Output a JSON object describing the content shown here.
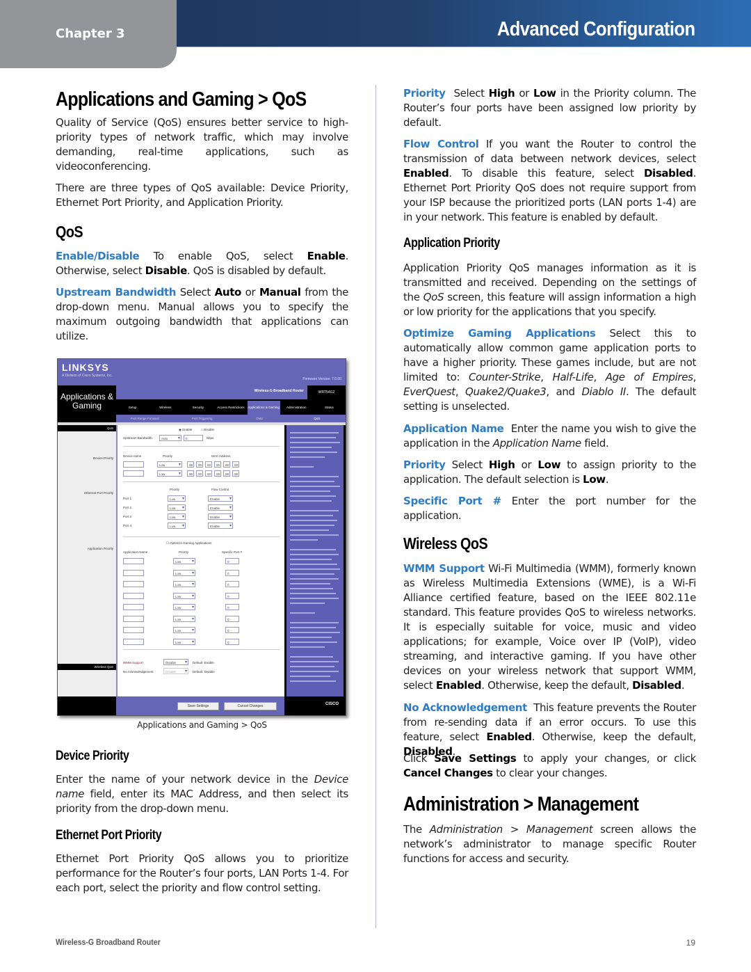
{
  "header": {
    "chapter": "Chapter 3",
    "title": "Advanced Configuration"
  },
  "left": {
    "title": "Applications and Gaming > QoS",
    "intro1": "Quality of Service (QoS) ensures better service to high-priority types of network traffic, which may involve demanding, real-time applications, such as videoconferencing.",
    "intro2": "There are three types of QoS available: Device Priority, Ethernet Port Priority, and Application Priority.",
    "qos_heading": "QoS",
    "enable_term": "Enable/Disable",
    "enable_t1": " To enable QoS, select ",
    "enable_b1": "Enable",
    "enable_t2": ". Otherwise, select ",
    "enable_b2": "Disable",
    "enable_t3": ". QoS is disabled by default.",
    "upstream_term": "Upstream Bandwidth",
    "upstream_t1": " Select ",
    "upstream_b1": "Auto",
    "upstream_t2": " or ",
    "upstream_b2": "Manual",
    "upstream_t3": " from the drop-down menu. Manual allows you to specify the maximum outgoing bandwidth that applications can utilize.",
    "figure_caption": "Applications and Gaming > QoS",
    "device_heading": "Device Priority",
    "device_t1": "Enter the name of your network device in the ",
    "device_i1": "Device name",
    "device_t2": " field, enter its MAC Address, and then select its priority from the drop-down menu.",
    "ethernet_heading": "Ethernet Port Priority",
    "ethernet_text": "Ethernet Port Priority QoS allows you to prioritize performance for the Router’s four ports, LAN Ports 1-4. For each port, select the priority and flow control setting."
  },
  "figure": {
    "logo": "LINKSYS",
    "logo_sub": "A Division of Cisco Systems, Inc.",
    "firmware": "Firmware Version: 7.0.00",
    "section": "Applications & Gaming",
    "product": "Wireless-G Broadband Router",
    "model": "WRT54G2",
    "tabs": [
      "Setup",
      "Wireless",
      "Security",
      "Access Restrictions",
      "Applications & Gaming",
      "Administration",
      "Status"
    ],
    "subtabs": [
      "Port Range Forward",
      "Port Triggering",
      "DMZ",
      "QoS"
    ],
    "left_labels": [
      "QoS",
      "Device Priority",
      "Ethernet Port Priority",
      "Application Priority",
      "Wireless QoS"
    ],
    "enable": "Enable",
    "disable": "Disable",
    "upstream_label": "Upstream Bandwidth",
    "upstream_value": "Auto",
    "upstream_kbps": "0",
    "kbps": "Kbps",
    "device_name": "Device name",
    "priority": "Priority",
    "mac_address": "MAC Address",
    "low": "Low",
    "mac_octet": "00",
    "flow_control": "Flow Control",
    "ports": [
      "Port 1",
      "Port 2",
      "Port 3",
      "Port 4"
    ],
    "enable_value": "Enable",
    "optimize": "Optimize Gaming Applications",
    "app_name": "Application Name",
    "specific_port": "Specific Port #",
    "port_value": "0",
    "wmm_support": "WMM Support",
    "wmm_value": "Disable",
    "no_ack": "No Acknowledgement",
    "no_ack_value": "Disable",
    "default_enable": "Default: Enable",
    "default_disable": "Default: Disable",
    "save": "Save Settings",
    "cancel": "Cancel Changes",
    "cisco": "CISCO"
  },
  "right": {
    "priority_term": "Priority",
    "priority_t1": "  Select ",
    "priority_b1": "High",
    "priority_t2": " or ",
    "priority_b2": "Low",
    "priority_t3": " in the Priority column. The Router’s four ports have been assigned low priority by default.",
    "flow_term": "Flow Control",
    "flow_t1": " If you want the Router to control the transmission of data between network devices, select ",
    "flow_b1": "Enabled",
    "flow_t2": ". To disable this feature, select ",
    "flow_b2": "Disabled",
    "flow_t3": ". Ethernet Port Priority QoS does not require support from your ISP because the prioritized ports (LAN ports 1-4) are in your network. This feature is enabled by default.",
    "app_heading": "Application Priority",
    "app_t1": "Application Priority QoS manages information as it is transmitted and received. Depending on the settings of the ",
    "app_i1": "QoS",
    "app_t2": " screen, this feature will assign information a high or low priority for the applications that you specify.",
    "opt_term": "Optimize Gaming Applications",
    "opt_t1": " Select this to automatically allow common game application ports to have a higher priority. These games include, but are not limited to: ",
    "opt_i1": "Counter-Strike",
    "opt_i2": "Half-Life",
    "opt_i3": "Age of Empires",
    "opt_i4": "EverQuest",
    "opt_i5": "Quake2/Quake3",
    "opt_i6": "Diablo II",
    "opt_sep": ", ",
    "opt_and": ", and ",
    "opt_t2": ". The default setting is unselected.",
    "appname_term": "Application Name",
    "appname_t1": "  Enter the name you wish to give the application in the ",
    "appname_i1": "Application Name",
    "appname_t2": " field.",
    "prio2_term": "Priority",
    "prio2_t1": " Select ",
    "prio2_b1": "High",
    "prio2_t2": " or ",
    "prio2_b2": "Low",
    "prio2_t3": " to assign priority to the application. The default selection is ",
    "prio2_b3": "Low",
    "prio2_t4": ".",
    "port_term": "Specific Port #",
    "port_t1": " Enter the port number for the application.",
    "wireless_heading": "Wireless QoS",
    "wmm_term": "WMM Support",
    "wmm_t1": " Wi-Fi Multimedia (WMM), formerly known as Wireless Multimedia Extensions (WME), is a Wi-Fi Alliance certified feature, based on the IEEE 802.11e standard. This feature provides QoS to wireless networks. It is especially suitable for voice, music and video applications; for example, Voice over IP (VoIP), video streaming, and interactive gaming. If you have other devices on your wireless network that support WMM, select ",
    "wmm_b1": "Enabled",
    "wmm_t2": ". Otherwise, keep the default, ",
    "wmm_b2": "Disabled",
    "wmm_t3": ".",
    "noack_term": "No Acknowledgement",
    "noack_t1": "  This feature prevents the Router from re-sending data if an error occurs. To use this feature, select ",
    "noack_b1": "Enabled",
    "noack_t2": ". Otherwise, keep the default, ",
    "noack_b2": "Disabled",
    "noack_t3": ".",
    "click_t1": "Click ",
    "click_b1": "Save Settings",
    "click_t2": " to apply your changes, or click ",
    "click_b2": "Cancel Changes",
    "click_t3": " to clear your changes.",
    "admin_heading": "Administration > Management",
    "admin_t1": "The ",
    "admin_i1": "Administration > Management",
    "admin_t2": " screen allows the network’s administrator to manage specific Router functions for access and security."
  },
  "footer": {
    "product": "Wireless-G Broadband Router",
    "page": "19"
  },
  "colors": {
    "term": "#2f7cc3",
    "header_dark": "#1e3259",
    "header_light": "#2c6db3",
    "chapter_tab": "#939598"
  }
}
